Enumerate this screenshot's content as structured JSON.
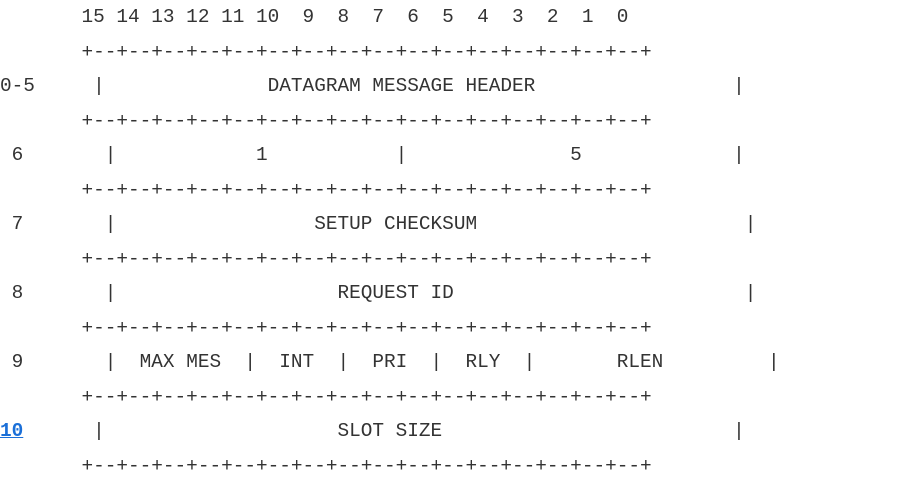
{
  "diagram": {
    "bit_header": "       15 14 13 12 11 10  9  8  7  6  5  4  3  2  1  0",
    "rows": [
      {
        "label": "0-5",
        "text": "     |              DATAGRAM MESSAGE HEADER                 |"
      },
      {
        "label": " 6",
        "text": "       |            1           |              5             |"
      },
      {
        "label": " 7",
        "text": "       |                 SETUP CHECKSUM                       |"
      },
      {
        "label": " 8",
        "text": "       |                   REQUEST ID                         |"
      },
      {
        "label": " 9",
        "text": "       |  MAX MES  |  INT  |  PRI  |  RLY  |       RLEN         |"
      },
      {
        "label": "10",
        "text": "      |                    SLOT SIZE                         |"
      }
    ],
    "separator": "       +--+--+--+--+--+--+--+--+--+--+--+--+--+--+--+--+",
    "link_color": "#1a6fd8"
  }
}
